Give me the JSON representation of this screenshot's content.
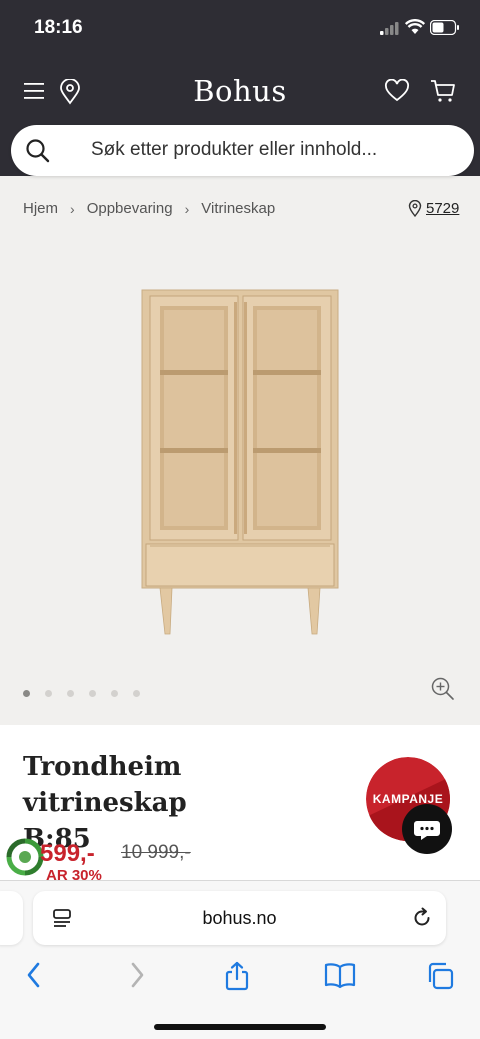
{
  "status_bar": {
    "time": "18:16"
  },
  "header": {
    "logo": "Bohus"
  },
  "search": {
    "placeholder": "Søk etter produkter eller innhold..."
  },
  "breadcrumb": {
    "items": [
      "Hjem",
      "Oppbevaring",
      "Vitrineskap"
    ]
  },
  "store": {
    "number": "5729"
  },
  "gallery": {
    "image_count": 6,
    "active_index": 0
  },
  "product": {
    "title_line1": "Trondheim vitrineskap",
    "title_line2": "B:85",
    "price": "599,-",
    "old_price": "10 999,-",
    "saving": "AR 30%",
    "badge": "KAMPANJE"
  },
  "browser": {
    "url": "bohus.no"
  },
  "colors": {
    "header_bg": "#2e2d34",
    "sale_red": "#c8232c",
    "browser_blue": "#1f7ae0"
  }
}
